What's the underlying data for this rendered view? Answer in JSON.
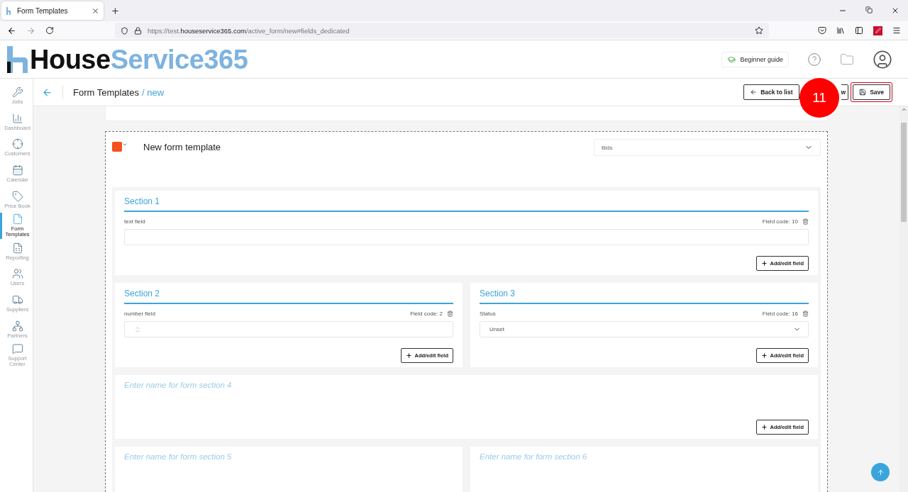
{
  "browser": {
    "tab_title": "Form Templates",
    "url": "https://test.**houseservice365.com**/active_form/new#fields_dedicated"
  },
  "logo": "House**Service365**",
  "header": {
    "guide_label": "Beginner guide"
  },
  "sidebar": [
    {
      "label": "Jobs",
      "kind": "jobs",
      "selected": false
    },
    {
      "label": "Dashboard",
      "kind": "dashboard",
      "selected": false
    },
    {
      "label": "Customers",
      "kind": "customers",
      "selected": false
    },
    {
      "label": "Calendar",
      "kind": "calendar",
      "selected": false
    },
    {
      "label": "Price Book",
      "kind": "pricebook",
      "selected": false
    },
    {
      "label": "Form Templates",
      "kind": "forms",
      "selected": true
    },
    {
      "label": "Reporting",
      "kind": "reporting",
      "selected": false
    },
    {
      "label": "Users",
      "kind": "users",
      "selected": false
    },
    {
      "label": "Suppliers",
      "kind": "suppliers",
      "selected": false
    },
    {
      "label": "Partners",
      "kind": "partners",
      "selected": false
    },
    {
      "label": "Support Center",
      "kind": "support",
      "selected": false
    }
  ],
  "page": {
    "title": "Form Templates",
    "current": "/ new"
  },
  "actions": [
    {
      "label": "Back to list",
      "kind": "back",
      "highlighted": false
    },
    {
      "label": "w",
      "kind": "plain",
      "highlighted": false
    },
    {
      "label": "Save",
      "kind": "save",
      "highlighted": true
    }
  ],
  "annotation": {
    "number": "11"
  },
  "form": {
    "color": "#f4511e",
    "title": "New form template",
    "category": "Bids"
  },
  "section_rows": [
    {
      "sections": [
        {
          "title": "Section 1",
          "fields": [
            {
              "label": "text field",
              "code": "Field code: 10",
              "kind": "text"
            }
          ],
          "button": "Add/edit field"
        }
      ]
    },
    {
      "sections": [
        {
          "title": "Section 2",
          "fields": [
            {
              "label": "number field",
              "code": "Field code: 2",
              "kind": "number"
            }
          ],
          "button": "Add/edit field"
        },
        {
          "title": "Section 3",
          "fields": [
            {
              "label": "Status",
              "code": "Field code: 16",
              "kind": "select",
              "value": "Unset"
            }
          ],
          "button": "Add/edit field"
        }
      ]
    },
    {
      "sections": [
        {
          "placeholder": "Enter name for form section 4",
          "button": "Add/edit field"
        }
      ]
    },
    {
      "sections": [
        {
          "placeholder": "Enter name for form section 5"
        },
        {
          "placeholder": "Enter name for form section 6"
        }
      ]
    }
  ]
}
